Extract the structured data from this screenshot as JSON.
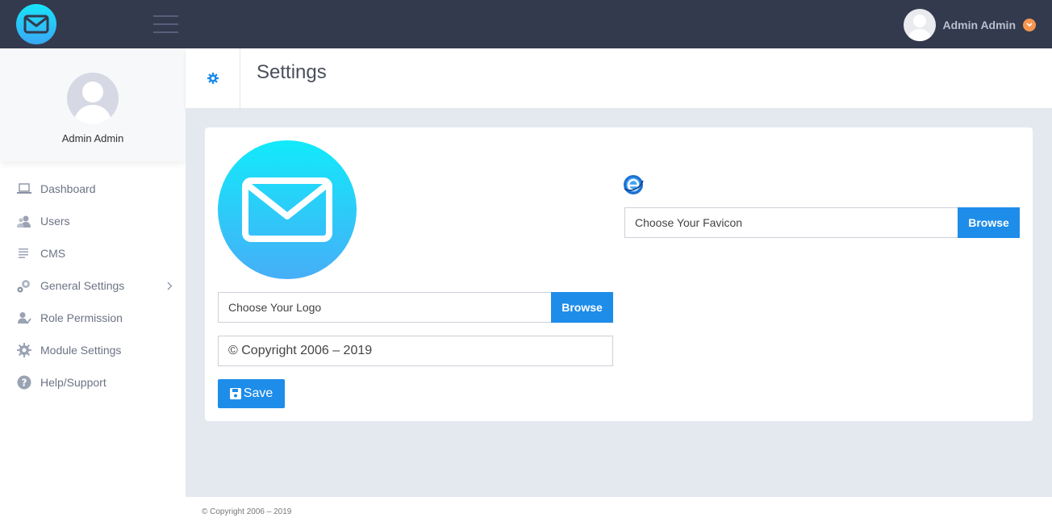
{
  "topbar": {
    "brand_icon": "envelope-icon",
    "menu_icon": "hamburger-icon",
    "user_name": "Admin Admin",
    "caret_icon": "chevron-down-icon",
    "colors": {
      "bg": "#333a4e",
      "caret": "#f5954f"
    }
  },
  "sidebar": {
    "profile_name": "Admin Admin",
    "items": [
      {
        "label": "Dashboard",
        "icon": "laptop-icon"
      },
      {
        "label": "Users",
        "icon": "users-icon"
      },
      {
        "label": "CMS",
        "icon": "list-icon"
      },
      {
        "label": "General Settings",
        "icon": "gears-icon",
        "has_submenu": true
      },
      {
        "label": "Role Permission",
        "icon": "user-check-icon"
      },
      {
        "label": "Module Settings",
        "icon": "gear-icon"
      },
      {
        "label": "Help/Support",
        "icon": "question-icon"
      }
    ]
  },
  "header": {
    "title": "Settings",
    "icon": "gear-icon"
  },
  "form": {
    "logo_file_label": "Choose Your Logo",
    "favicon_file_label": "Choose Your Favicon",
    "browse_label": "Browse",
    "copyright_value": "© Copyright 2006 – 2019",
    "save_label": "Save",
    "colors": {
      "accent": "#1e8ce9"
    }
  },
  "footer": {
    "text": "© Copyright 2006 – 2019"
  }
}
